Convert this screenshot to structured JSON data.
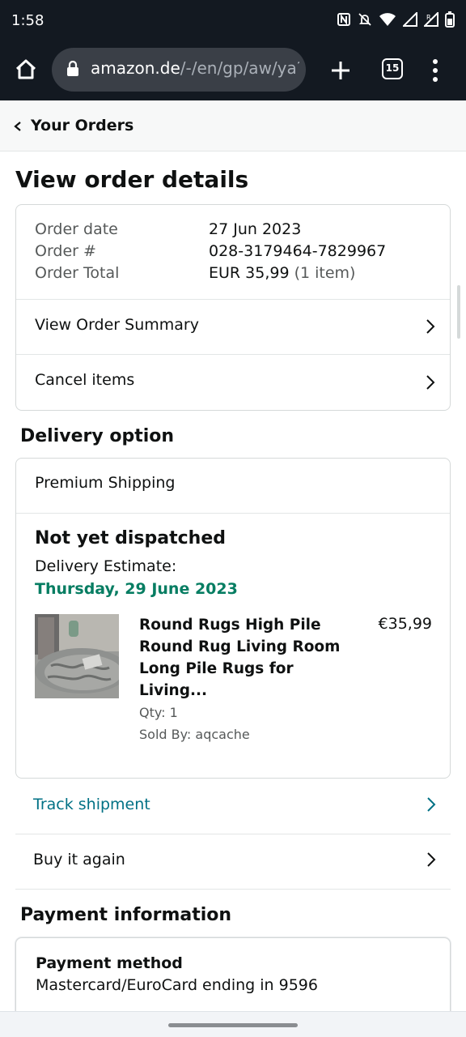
{
  "status_bar": {
    "time": "1:58"
  },
  "browser": {
    "url_host": "amazon.de",
    "url_path": "/-/en/gp/aw/ya?",
    "tab_count": "15"
  },
  "header": {
    "back_label": "Your Orders"
  },
  "page": {
    "title": "View order details"
  },
  "order": {
    "date_label": "Order date",
    "date_value": "27 Jun 2023",
    "number_label": "Order #",
    "number_value": "028-3179464-7829967",
    "total_label": "Order Total",
    "total_value": "EUR 35,99",
    "total_items": "(1 item)",
    "view_summary": "View Order Summary",
    "cancel_items": "Cancel items"
  },
  "delivery": {
    "section_title": "Delivery option",
    "shipping_method": "Premium Shipping",
    "status": "Not yet dispatched",
    "estimate_label": "Delivery Estimate:",
    "estimate_date": "Thursday, 29 June 2023",
    "product": {
      "title": "Round Rugs High Pile Round Rug Living Room Long Pile Rugs for Living...",
      "price": "€35,99",
      "qty": "Qty: 1",
      "sold_by": "Sold By: aqcache"
    },
    "track_shipment": "Track shipment",
    "buy_again": "Buy it again"
  },
  "payment": {
    "section_title": "Payment information",
    "method_title": "Payment method",
    "method_value": "Mastercard/EuroCard  ending in 9596"
  },
  "colors": {
    "browser_bar": "#131921",
    "delivery_green": "#067d62",
    "link_teal": "#007185"
  },
  "icons": [
    "home-icon",
    "lock-icon",
    "plus-icon",
    "tabs-icon",
    "menu-icon",
    "chevron-left-icon",
    "chevron-right-icon"
  ]
}
